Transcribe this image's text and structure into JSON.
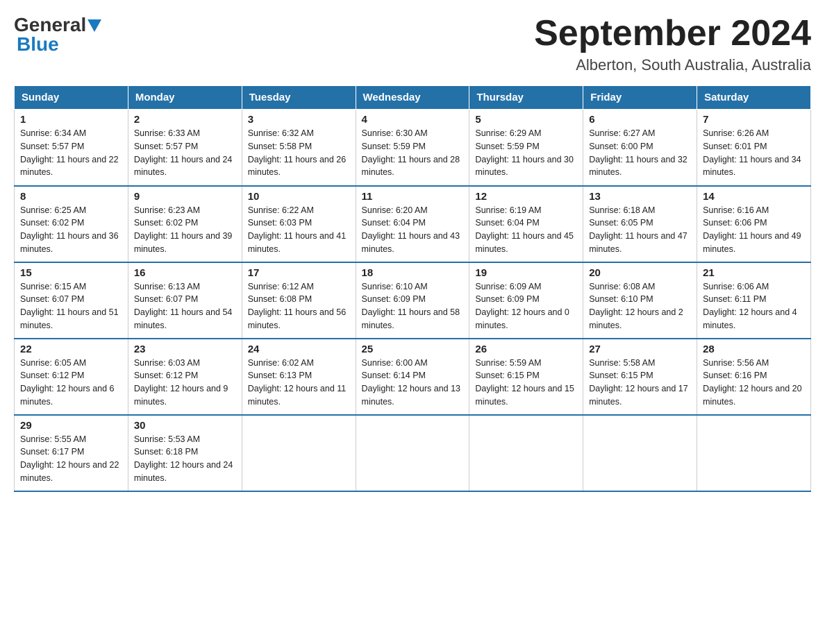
{
  "header": {
    "logo_general": "General",
    "logo_blue": "Blue",
    "month_title": "September 2024",
    "location": "Alberton, South Australia, Australia"
  },
  "days_of_week": [
    "Sunday",
    "Monday",
    "Tuesday",
    "Wednesday",
    "Thursday",
    "Friday",
    "Saturday"
  ],
  "weeks": [
    [
      {
        "day": "1",
        "sunrise": "6:34 AM",
        "sunset": "5:57 PM",
        "daylight": "11 hours and 22 minutes."
      },
      {
        "day": "2",
        "sunrise": "6:33 AM",
        "sunset": "5:57 PM",
        "daylight": "11 hours and 24 minutes."
      },
      {
        "day": "3",
        "sunrise": "6:32 AM",
        "sunset": "5:58 PM",
        "daylight": "11 hours and 26 minutes."
      },
      {
        "day": "4",
        "sunrise": "6:30 AM",
        "sunset": "5:59 PM",
        "daylight": "11 hours and 28 minutes."
      },
      {
        "day": "5",
        "sunrise": "6:29 AM",
        "sunset": "5:59 PM",
        "daylight": "11 hours and 30 minutes."
      },
      {
        "day": "6",
        "sunrise": "6:27 AM",
        "sunset": "6:00 PM",
        "daylight": "11 hours and 32 minutes."
      },
      {
        "day": "7",
        "sunrise": "6:26 AM",
        "sunset": "6:01 PM",
        "daylight": "11 hours and 34 minutes."
      }
    ],
    [
      {
        "day": "8",
        "sunrise": "6:25 AM",
        "sunset": "6:02 PM",
        "daylight": "11 hours and 36 minutes."
      },
      {
        "day": "9",
        "sunrise": "6:23 AM",
        "sunset": "6:02 PM",
        "daylight": "11 hours and 39 minutes."
      },
      {
        "day": "10",
        "sunrise": "6:22 AM",
        "sunset": "6:03 PM",
        "daylight": "11 hours and 41 minutes."
      },
      {
        "day": "11",
        "sunrise": "6:20 AM",
        "sunset": "6:04 PM",
        "daylight": "11 hours and 43 minutes."
      },
      {
        "day": "12",
        "sunrise": "6:19 AM",
        "sunset": "6:04 PM",
        "daylight": "11 hours and 45 minutes."
      },
      {
        "day": "13",
        "sunrise": "6:18 AM",
        "sunset": "6:05 PM",
        "daylight": "11 hours and 47 minutes."
      },
      {
        "day": "14",
        "sunrise": "6:16 AM",
        "sunset": "6:06 PM",
        "daylight": "11 hours and 49 minutes."
      }
    ],
    [
      {
        "day": "15",
        "sunrise": "6:15 AM",
        "sunset": "6:07 PM",
        "daylight": "11 hours and 51 minutes."
      },
      {
        "day": "16",
        "sunrise": "6:13 AM",
        "sunset": "6:07 PM",
        "daylight": "11 hours and 54 minutes."
      },
      {
        "day": "17",
        "sunrise": "6:12 AM",
        "sunset": "6:08 PM",
        "daylight": "11 hours and 56 minutes."
      },
      {
        "day": "18",
        "sunrise": "6:10 AM",
        "sunset": "6:09 PM",
        "daylight": "11 hours and 58 minutes."
      },
      {
        "day": "19",
        "sunrise": "6:09 AM",
        "sunset": "6:09 PM",
        "daylight": "12 hours and 0 minutes."
      },
      {
        "day": "20",
        "sunrise": "6:08 AM",
        "sunset": "6:10 PM",
        "daylight": "12 hours and 2 minutes."
      },
      {
        "day": "21",
        "sunrise": "6:06 AM",
        "sunset": "6:11 PM",
        "daylight": "12 hours and 4 minutes."
      }
    ],
    [
      {
        "day": "22",
        "sunrise": "6:05 AM",
        "sunset": "6:12 PM",
        "daylight": "12 hours and 6 minutes."
      },
      {
        "day": "23",
        "sunrise": "6:03 AM",
        "sunset": "6:12 PM",
        "daylight": "12 hours and 9 minutes."
      },
      {
        "day": "24",
        "sunrise": "6:02 AM",
        "sunset": "6:13 PM",
        "daylight": "12 hours and 11 minutes."
      },
      {
        "day": "25",
        "sunrise": "6:00 AM",
        "sunset": "6:14 PM",
        "daylight": "12 hours and 13 minutes."
      },
      {
        "day": "26",
        "sunrise": "5:59 AM",
        "sunset": "6:15 PM",
        "daylight": "12 hours and 15 minutes."
      },
      {
        "day": "27",
        "sunrise": "5:58 AM",
        "sunset": "6:15 PM",
        "daylight": "12 hours and 17 minutes."
      },
      {
        "day": "28",
        "sunrise": "5:56 AM",
        "sunset": "6:16 PM",
        "daylight": "12 hours and 20 minutes."
      }
    ],
    [
      {
        "day": "29",
        "sunrise": "5:55 AM",
        "sunset": "6:17 PM",
        "daylight": "12 hours and 22 minutes."
      },
      {
        "day": "30",
        "sunrise": "5:53 AM",
        "sunset": "6:18 PM",
        "daylight": "12 hours and 24 minutes."
      },
      null,
      null,
      null,
      null,
      null
    ]
  ]
}
